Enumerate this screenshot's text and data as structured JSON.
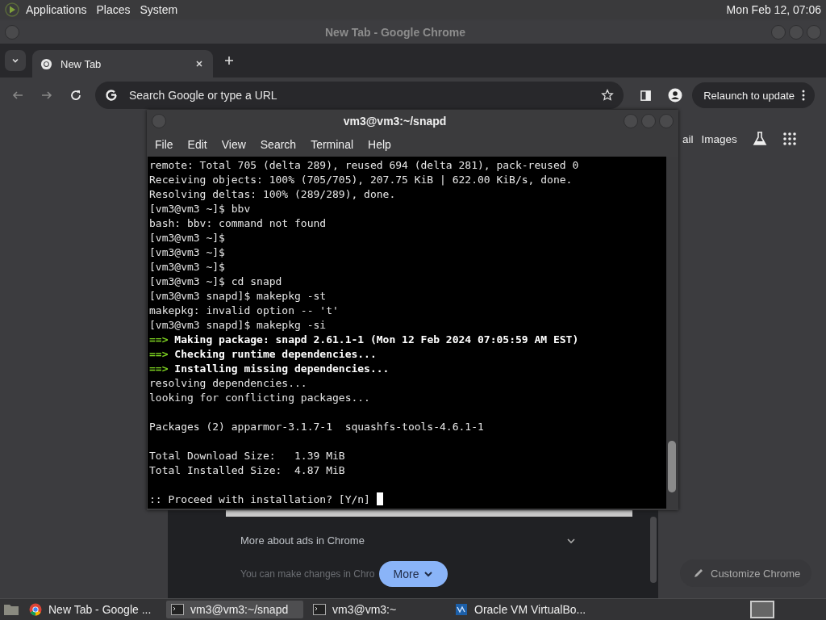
{
  "top_panel": {
    "menus": [
      "Applications",
      "Places",
      "System"
    ],
    "clock": "Mon Feb 12, 07:06"
  },
  "browser": {
    "title": "New Tab - Google Chrome",
    "tabs": [
      {
        "label": "New Tab",
        "selected": true
      }
    ],
    "address": {
      "placeholder": "Search Google or type a URL"
    },
    "relaunch": "Relaunch to update",
    "header_links": [
      "ail",
      "Images"
    ],
    "ads_row": "More about ads in Chrome",
    "faded_text": "You can make changes in Chro",
    "more_button": "More",
    "customize": "Customize Chrome"
  },
  "terminal": {
    "title": "vm3@vm3:~/snapd",
    "menus": [
      "File",
      "Edit",
      "View",
      "Search",
      "Terminal",
      "Help"
    ],
    "lines": [
      {
        "kind": "plain",
        "text": "remote: Total 705 (delta 289), reused 694 (delta 281), pack-reused 0"
      },
      {
        "kind": "plain",
        "text": "Receiving objects: 100% (705/705), 207.75 KiB | 622.00 KiB/s, done."
      },
      {
        "kind": "plain",
        "text": "Resolving deltas: 100% (289/289), done."
      },
      {
        "kind": "plain",
        "text": "[vm3@vm3 ~]$ bbv"
      },
      {
        "kind": "plain",
        "text": "bash: bbv: command not found"
      },
      {
        "kind": "plain",
        "text": "[vm3@vm3 ~]$"
      },
      {
        "kind": "plain",
        "text": "[vm3@vm3 ~]$"
      },
      {
        "kind": "plain",
        "text": "[vm3@vm3 ~]$"
      },
      {
        "kind": "plain",
        "text": "[vm3@vm3 ~]$ cd snapd"
      },
      {
        "kind": "plain",
        "text": "[vm3@vm3 snapd]$ makepkg -st"
      },
      {
        "kind": "plain",
        "text": "makepkg: invalid option -- 't'"
      },
      {
        "kind": "plain",
        "text": "[vm3@vm3 snapd]$ makepkg -si"
      },
      {
        "kind": "heading",
        "marker": "==>",
        "text": "Making package: snapd 2.61.1-1 (Mon 12 Feb 2024 07:05:59 AM EST)"
      },
      {
        "kind": "heading",
        "marker": "==>",
        "text": "Checking runtime dependencies..."
      },
      {
        "kind": "heading",
        "marker": "==>",
        "text": "Installing missing dependencies..."
      },
      {
        "kind": "plain",
        "text": "resolving dependencies..."
      },
      {
        "kind": "plain",
        "text": "looking for conflicting packages..."
      },
      {
        "kind": "blank"
      },
      {
        "kind": "plain",
        "text": "Packages (2) apparmor-3.1.7-1  squashfs-tools-4.6.1-1"
      },
      {
        "kind": "blank"
      },
      {
        "kind": "plain",
        "text": "Total Download Size:   1.39 MiB"
      },
      {
        "kind": "plain",
        "text": "Total Installed Size:  4.87 MiB"
      },
      {
        "kind": "blank"
      },
      {
        "kind": "prompt",
        "text": ":: Proceed with installation? [Y/n]"
      }
    ]
  },
  "taskbar": {
    "items": [
      {
        "kind": "browser",
        "label": "New Tab - Google ...",
        "selected": false
      },
      {
        "kind": "terminal",
        "label": "vm3@vm3:~/snapd",
        "selected": true
      },
      {
        "kind": "terminal",
        "label": "vm3@vm3:~",
        "selected": false
      },
      {
        "kind": "virtualbox",
        "label": "Oracle VM VirtualBo...",
        "selected": false
      }
    ]
  }
}
